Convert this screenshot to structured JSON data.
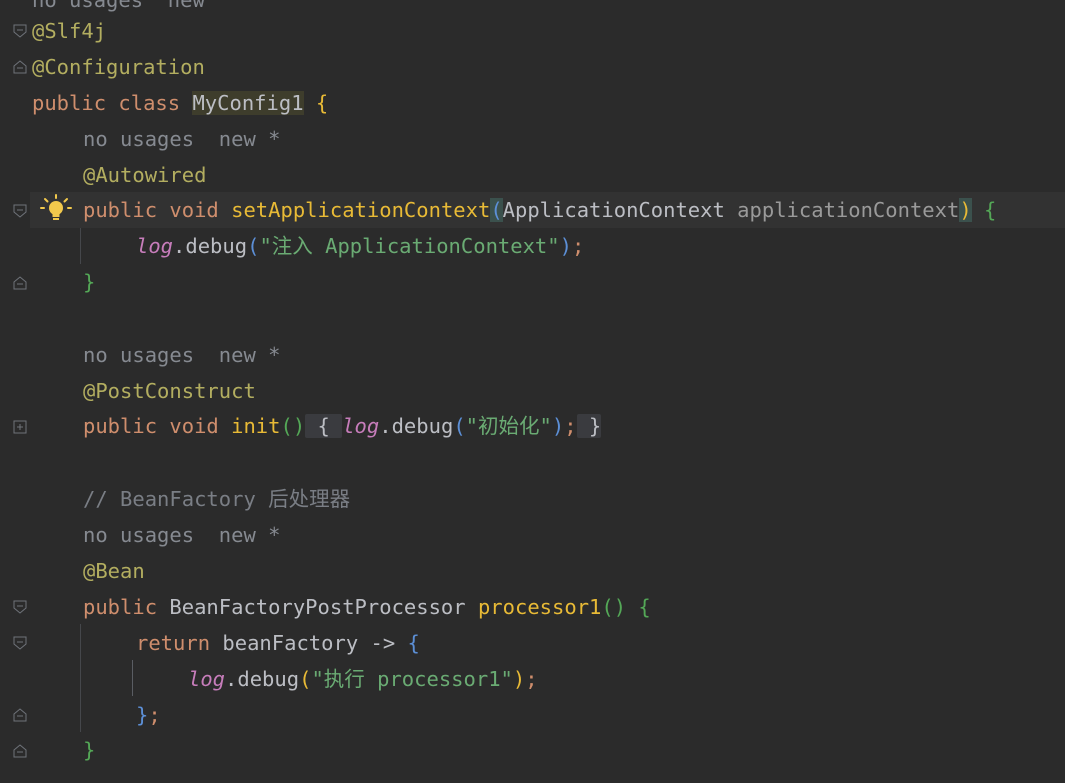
{
  "editor": {
    "top_hint": "no usages  new",
    "lines": {
      "slf4j": "@Slf4j",
      "configuration": "@Configuration",
      "class_public": "public",
      "class_kw": "class",
      "class_name": "MyConfig1",
      "open_brace": "{",
      "hint1": "no usages  new *",
      "autowired": "@Autowired",
      "m1_public": "public",
      "m1_void": "void",
      "m1_name": "setApplicationContext",
      "m1_paren_open": "(",
      "m1_param_type": "ApplicationContext",
      "m1_param_name": "applicationContext",
      "m1_paren_close": ")",
      "m1_open": "{",
      "m1_log": "log",
      "m1_dot": ".",
      "m1_call": "debug",
      "m1_args_open": "(",
      "m1_str": "\"注入 ApplicationContext\"",
      "m1_args_close": ")",
      "m1_semi": ";",
      "m1_close": "}",
      "hint2": "no usages  new *",
      "postconstruct": "@PostConstruct",
      "m2_public": "public",
      "m2_void": "void",
      "m2_name": "init",
      "m2_parens": "()",
      "m2_fold_open": " { ",
      "m2_log": "log",
      "m2_dot": ".",
      "m2_call": "debug",
      "m2_args_open": "(",
      "m2_str": "\"初始化\"",
      "m2_args_close": ")",
      "m2_semi": ";",
      "m2_fold_close": " }",
      "comment": "// BeanFactory 后处理器",
      "hint3": "no usages  new *",
      "bean": "@Bean",
      "m3_public": "public",
      "m3_type": "BeanFactoryPostProcessor",
      "m3_name": "processor1",
      "m3_parens": "()",
      "m3_open": "{",
      "ret_kw": "return",
      "ret_var": "beanFactory",
      "ret_arrow": "->",
      "ret_open": "{",
      "l_log": "log",
      "l_dot": ".",
      "l_call": "debug",
      "l_args_open": "(",
      "l_str": "\"执行 processor1\"",
      "l_args_close": ")",
      "l_semi": ";",
      "lambda_close": "}",
      "lambda_semi": ";",
      "m3_close": "}"
    }
  }
}
